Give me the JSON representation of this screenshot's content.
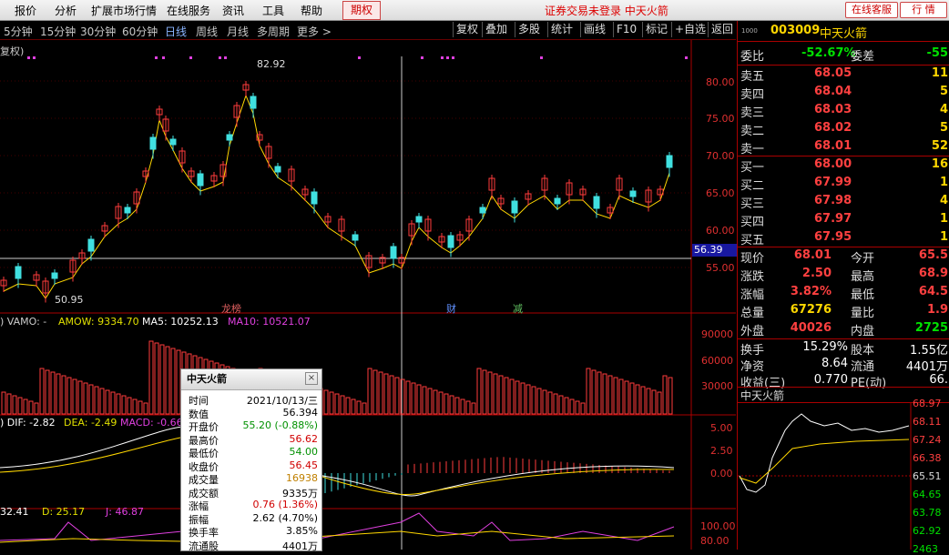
{
  "menu": {
    "items": [
      "报价",
      "分析",
      "扩展市场行情",
      "在线服务",
      "资讯",
      "工具",
      "帮助"
    ],
    "active": "期权",
    "center_text": "证券交易未登录 中天火箭",
    "online_service_btn": "在线客服",
    "quote_btn": "行 情"
  },
  "periods": {
    "items": [
      "5分钟",
      "15分钟",
      "30分钟",
      "60分钟",
      "日线",
      "周线",
      "月线",
      "多周期",
      "更多 >"
    ],
    "active_index": 4
  },
  "toolbar": {
    "items": [
      "复权",
      "叠加",
      "多股",
      "统计",
      "画线",
      "F10",
      "标记",
      "+自选",
      "返回"
    ]
  },
  "main_chart": {
    "label": "复权)",
    "high_label": "82.92",
    "low_label": "50.95",
    "y_ticks": [
      "80.00",
      "75.00",
      "70.00",
      "65.00",
      "60.00",
      "55.00"
    ],
    "current_price_tag": "56.39",
    "events": [
      "龙榜",
      "财",
      "减"
    ]
  },
  "volume": {
    "label": ") VAMO: -",
    "amow": "AMOW: 9334.70",
    "ma5": "MA5: 10252.13",
    "ma10": "MA10: 10521.07",
    "y_ticks": [
      "90000",
      "60000",
      "30000"
    ]
  },
  "macd": {
    "dif": ") DIF: -2.82",
    "dea": "DEA: -2.49",
    "macd": "MACD: -0.66",
    "y_ticks": [
      "5.00",
      "2.50",
      "0.00"
    ]
  },
  "kdj": {
    "k": "32.41",
    "d": "D: 25.17",
    "j": "J: 46.87",
    "y_ticks": [
      "100.00",
      "80.00"
    ]
  },
  "tooltip": {
    "title": "中天火箭",
    "close": "×",
    "rows": [
      {
        "label": "时间",
        "value": "2021/10/13/三",
        "color": "#000"
      },
      {
        "label": "数值",
        "value": "56.394",
        "color": "#000"
      },
      {
        "label": "开盘价",
        "value": "55.20 (-0.88%)",
        "color": "#009000"
      },
      {
        "label": "最高价",
        "value": "56.62",
        "color": "#d00000"
      },
      {
        "label": "最低价",
        "value": "54.00",
        "color": "#009000"
      },
      {
        "label": "收盘价",
        "value": "56.45",
        "color": "#d00000"
      },
      {
        "label": "成交量",
        "value": "16938",
        "color": "#c08000"
      },
      {
        "label": "成交额",
        "value": "9335万",
        "color": "#000"
      },
      {
        "label": "涨幅",
        "value": "0.76 (1.36%)",
        "color": "#d00000"
      },
      {
        "label": "振幅",
        "value": "2.62 (4.70%)",
        "color": "#000"
      },
      {
        "label": "换手率",
        "value": "3.85%",
        "color": "#000"
      },
      {
        "label": "流通股",
        "value": "4401万",
        "color": "#000"
      }
    ]
  },
  "quote": {
    "code": "003009",
    "name": "中天火箭",
    "code_prefix": "1000",
    "webi_label": "委比",
    "webi_value": "-52.67%",
    "wecha_label": "委差",
    "wecha_value": "-55",
    "asks": [
      {
        "label": "卖五",
        "price": "68.05",
        "vol": "11"
      },
      {
        "label": "卖四",
        "price": "68.04",
        "vol": "5"
      },
      {
        "label": "卖三",
        "price": "68.03",
        "vol": "4"
      },
      {
        "label": "卖二",
        "price": "68.02",
        "vol": "5"
      },
      {
        "label": "卖一",
        "price": "68.01",
        "vol": "52"
      }
    ],
    "bids": [
      {
        "label": "买一",
        "price": "68.00",
        "vol": "16"
      },
      {
        "label": "买二",
        "price": "67.99",
        "vol": "1"
      },
      {
        "label": "买三",
        "price": "67.98",
        "vol": "4"
      },
      {
        "label": "买四",
        "price": "67.97",
        "vol": "1"
      },
      {
        "label": "买五",
        "price": "67.95",
        "vol": "1"
      }
    ],
    "stats": [
      {
        "l1": "现价",
        "v1": "68.01",
        "c1": "red",
        "l2": "今开",
        "v2": "65.5",
        "c2": "red"
      },
      {
        "l1": "涨跌",
        "v1": "2.50",
        "c1": "red",
        "l2": "最高",
        "v2": "68.9",
        "c2": "red"
      },
      {
        "l1": "涨幅",
        "v1": "3.82%",
        "c1": "red",
        "l2": "最低",
        "v2": "64.5",
        "c2": "red"
      },
      {
        "l1": "总量",
        "v1": "67276",
        "c1": "yel",
        "l2": "量比",
        "v2": "1.9",
        "c2": "red"
      },
      {
        "l1": "外盘",
        "v1": "40026",
        "c1": "red",
        "l2": "内盘",
        "v2": "2725",
        "c2": "grn"
      }
    ],
    "stats2": [
      {
        "l1": "换手",
        "v1": "15.29%",
        "l2": "股本",
        "v2": "1.55亿"
      },
      {
        "l1": "净资",
        "v1": "8.64",
        "l2": "流通",
        "v2": "4401万"
      },
      {
        "l1": "收益(三)",
        "v1": "0.770",
        "l2": "PE(动)",
        "v2": "66."
      }
    ],
    "mini_title": "中天火箭",
    "mini_ticks": [
      "68.97",
      "68.11",
      "67.24",
      "66.38",
      "65.51",
      "64.65",
      "63.78",
      "62.92",
      "2463"
    ]
  }
}
